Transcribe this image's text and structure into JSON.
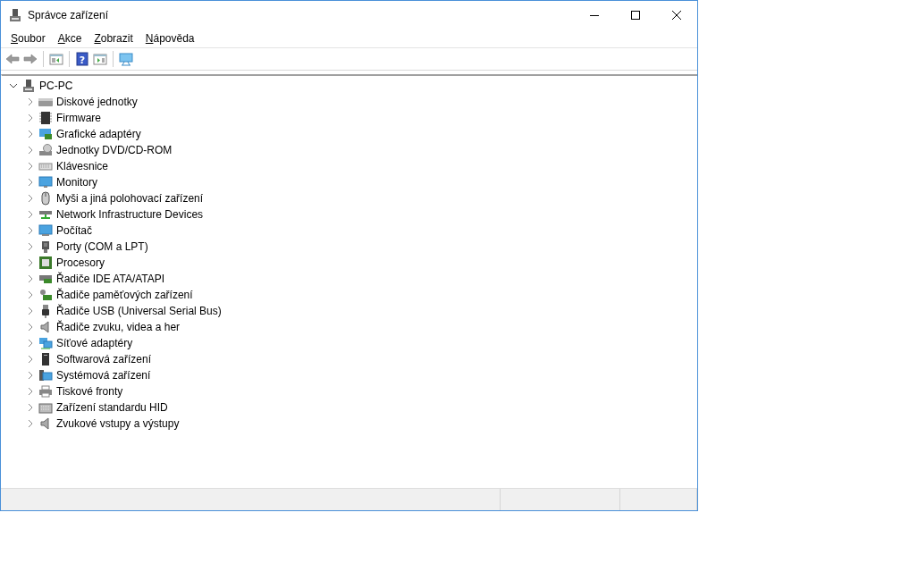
{
  "window": {
    "title": "Správce zařízení"
  },
  "menu": [
    "Soubor",
    "Akce",
    "Zobrazit",
    "Nápověda"
  ],
  "toolbar": {
    "help_glyph": "?"
  },
  "tree": {
    "label": "PC-PC",
    "expanded": true,
    "children": [
      {
        "label": "Diskové jednotky",
        "expanded": false
      },
      {
        "label": "Firmware",
        "expanded": false
      },
      {
        "label": "Grafické adaptéry",
        "expanded": false
      },
      {
        "label": "Jednotky DVD/CD-ROM",
        "expanded": false
      },
      {
        "label": "Klávesnice",
        "expanded": false
      },
      {
        "label": "Monitory",
        "expanded": false
      },
      {
        "label": "Myši a jiná polohovací zařízení",
        "expanded": false
      },
      {
        "label": "Network Infrastructure Devices",
        "expanded": false
      },
      {
        "label": "Počítač",
        "expanded": false
      },
      {
        "label": "Porty (COM a LPT)",
        "expanded": false
      },
      {
        "label": "Procesory",
        "expanded": false
      },
      {
        "label": "Řadiče IDE ATA/ATAPI",
        "expanded": false
      },
      {
        "label": "Řadiče paměťových zařízení",
        "expanded": false
      },
      {
        "label": "Řadiče USB (Universal Serial Bus)",
        "expanded": false
      },
      {
        "label": "Řadiče zvuku, videa a her",
        "expanded": false
      },
      {
        "label": "Síťové adaptéry",
        "expanded": false
      },
      {
        "label": "Softwarová zařízení",
        "expanded": false
      },
      {
        "label": "Systémová zařízení",
        "expanded": false
      },
      {
        "label": "Tiskové fronty",
        "expanded": false
      },
      {
        "label": "Zařízení standardu HID",
        "expanded": false
      },
      {
        "label": "Zvukové vstupy a výstupy",
        "expanded": false
      }
    ]
  }
}
